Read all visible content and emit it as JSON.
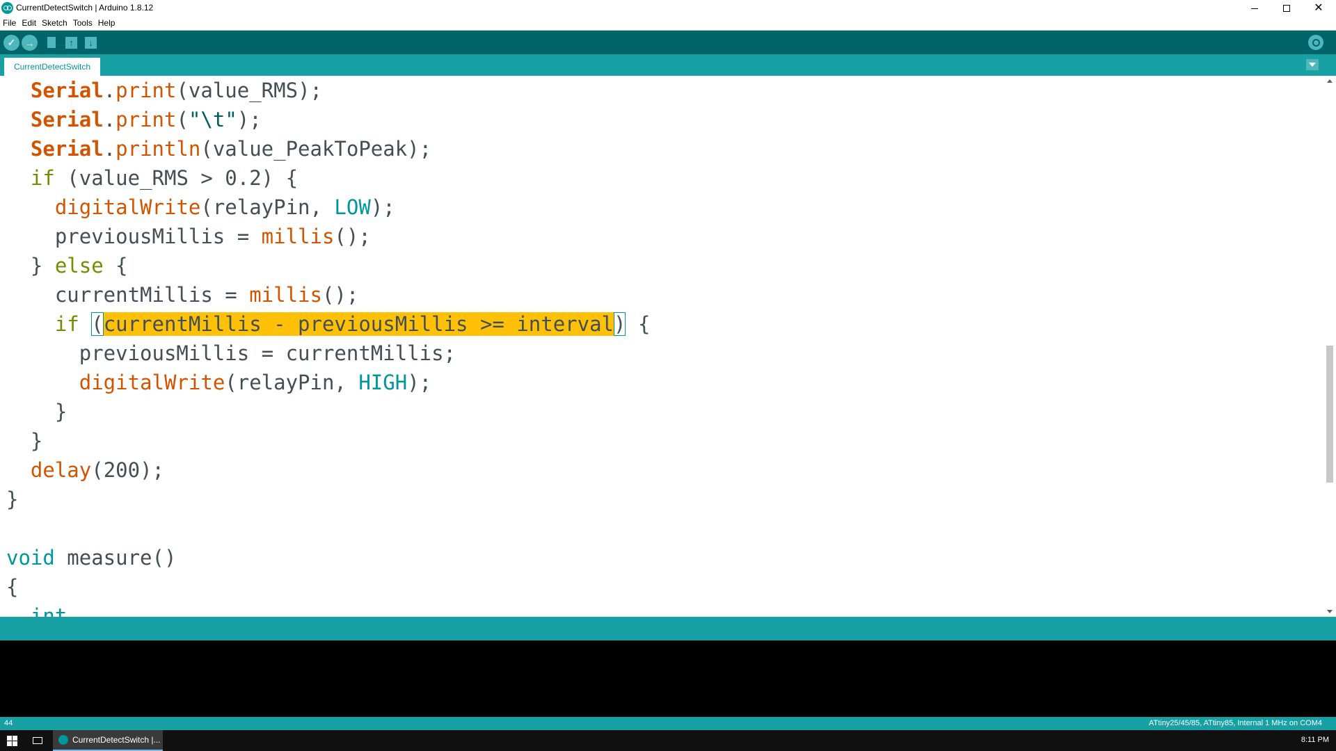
{
  "window": {
    "title": "CurrentDetectSwitch | Arduino 1.8.12",
    "controls": {
      "minimize": "—",
      "maximize": "☐",
      "close": "✕"
    }
  },
  "menu": [
    "File",
    "Edit",
    "Sketch",
    "Tools",
    "Help"
  ],
  "toolbar": {
    "verify_icon": "checkmark-icon",
    "upload_icon": "right-arrow-icon",
    "new_icon": "new-file-icon",
    "open_icon": "open-up-arrow-icon",
    "save_icon": "save-down-arrow-icon",
    "serial_monitor_icon": "magnifier-icon",
    "verify_glyph": "✓",
    "upload_glyph": "→",
    "open_glyph": "↑",
    "save_glyph": "↓"
  },
  "tabs": [
    {
      "label": "CurrentDetectSwitch",
      "active": true
    }
  ],
  "editor": {
    "lines": [
      [
        {
          "t": "  "
        },
        {
          "t": "Serial",
          "c": "cls"
        },
        {
          "t": "."
        },
        {
          "t": "print",
          "c": "fn"
        },
        {
          "t": "(value_RMS);"
        }
      ],
      [
        {
          "t": "  "
        },
        {
          "t": "Serial",
          "c": "cls"
        },
        {
          "t": "."
        },
        {
          "t": "print",
          "c": "fn"
        },
        {
          "t": "("
        },
        {
          "t": "\"\\t\"",
          "c": "str"
        },
        {
          "t": ");"
        }
      ],
      [
        {
          "t": "  "
        },
        {
          "t": "Serial",
          "c": "cls"
        },
        {
          "t": "."
        },
        {
          "t": "println",
          "c": "fn"
        },
        {
          "t": "(value_PeakToPeak);"
        }
      ],
      [
        {
          "t": "  "
        },
        {
          "t": "if",
          "c": "ctl"
        },
        {
          "t": " (value_RMS > 0.2) {"
        }
      ],
      [
        {
          "t": "    "
        },
        {
          "t": "digitalWrite",
          "c": "fn"
        },
        {
          "t": "(relayPin, "
        },
        {
          "t": "LOW",
          "c": "const"
        },
        {
          "t": ");"
        }
      ],
      [
        {
          "t": "    previousMillis = "
        },
        {
          "t": "millis",
          "c": "fn"
        },
        {
          "t": "();"
        }
      ],
      [
        {
          "t": "  } "
        },
        {
          "t": "else",
          "c": "ctl"
        },
        {
          "t": " {"
        }
      ],
      [
        {
          "t": "    currentMillis = "
        },
        {
          "t": "millis",
          "c": "fn"
        },
        {
          "t": "();"
        }
      ],
      [
        {
          "t": "    "
        },
        {
          "t": "if",
          "c": "ctl"
        },
        {
          "t": " "
        },
        {
          "t": "(",
          "c": "brk"
        },
        {
          "t": "currentMillis - previousMillis >= interval",
          "c": "sel"
        },
        {
          "t": ")",
          "c": "brk"
        },
        {
          "t": " {"
        }
      ],
      [
        {
          "t": "      previousMillis = currentMillis;"
        }
      ],
      [
        {
          "t": "      "
        },
        {
          "t": "digitalWrite",
          "c": "fn"
        },
        {
          "t": "(relayPin, "
        },
        {
          "t": "HIGH",
          "c": "const"
        },
        {
          "t": ");"
        }
      ],
      [
        {
          "t": "    }"
        }
      ],
      [
        {
          "t": "  }"
        }
      ],
      [
        {
          "t": "  "
        },
        {
          "t": "delay",
          "c": "fn"
        },
        {
          "t": "(200);"
        }
      ],
      [
        {
          "t": "}"
        }
      ],
      [
        {
          "t": ""
        }
      ],
      [
        {
          "t": "void",
          "c": "kw"
        },
        {
          "t": " measure()"
        }
      ],
      [
        {
          "t": "{"
        }
      ],
      [
        {
          "t": "  "
        },
        {
          "t": "int",
          "c": "kw"
        },
        {
          "t": " "
        }
      ]
    ]
  },
  "status": {
    "line_number": "44",
    "board": "ATtiny25/45/85, ATtiny85, Internal 1 MHz on COM4"
  },
  "taskbar": {
    "start_icon": "windows-logo-icon",
    "task_view_icon": "task-view-icon",
    "app_label": "CurrentDetectSwitch |...",
    "clock": "8:11 PM"
  },
  "colors": {
    "teal_dark": "#006468",
    "teal": "#17a1a5",
    "selection": "#ffc107",
    "keyword": "#00979c",
    "function": "#d35400",
    "control": "#728e00"
  }
}
